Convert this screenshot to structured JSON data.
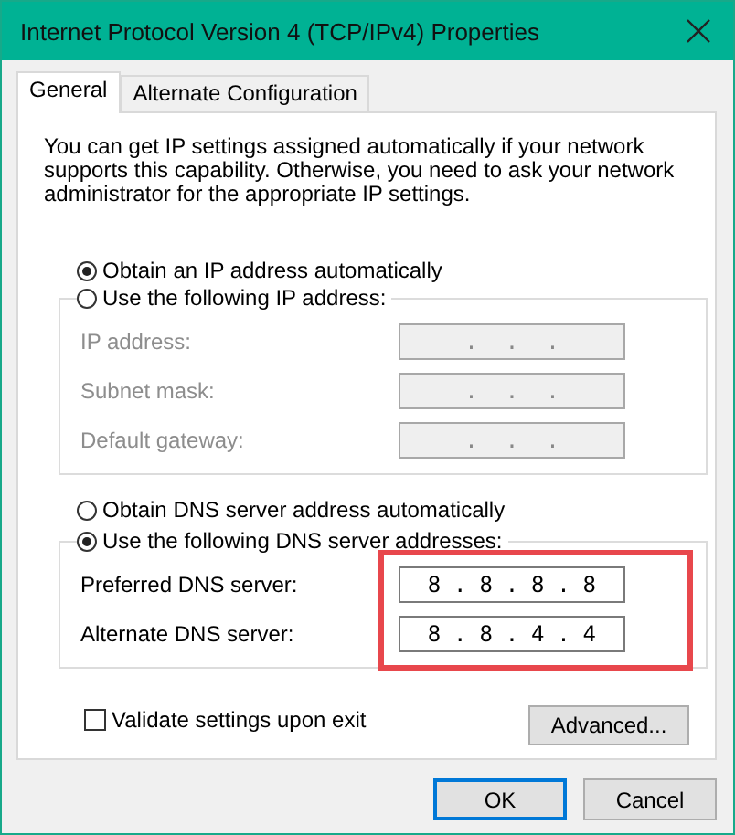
{
  "window": {
    "title": "Internet Protocol Version 4 (TCP/IPv4) Properties"
  },
  "tabs": [
    {
      "label": "General",
      "selected": true
    },
    {
      "label": "Alternate Configuration",
      "selected": false
    }
  ],
  "intro": "You can get IP settings assigned automatically if your network supports this capability. Otherwise, you need to ask your network administrator for the appropriate IP settings.",
  "ip_options": [
    {
      "label": "Obtain an IP address automatically",
      "selected": true
    },
    {
      "label": "Use the following IP address:",
      "selected": false
    }
  ],
  "ip_fields": [
    {
      "label": "IP address:",
      "disabled": true,
      "parts": [
        ".",
        ".",
        "."
      ]
    },
    {
      "label": "Subnet mask:",
      "disabled": true,
      "parts": [
        ".",
        ".",
        "."
      ]
    },
    {
      "label": "Default gateway:",
      "disabled": true,
      "parts": [
        ".",
        ".",
        "."
      ]
    }
  ],
  "dns_options": [
    {
      "label": "Obtain DNS server address automatically",
      "selected": false
    },
    {
      "label": "Use the following DNS server addresses:",
      "selected": true
    }
  ],
  "dns_fields": [
    {
      "label": "Preferred DNS server:",
      "disabled": false,
      "parts": [
        "8",
        ".",
        "8",
        ".",
        "8",
        ".",
        "8"
      ]
    },
    {
      "label": "Alternate DNS server:",
      "disabled": false,
      "parts": [
        "8",
        ".",
        "8",
        ".",
        "4",
        ".",
        "4"
      ]
    }
  ],
  "validate": {
    "label": "Validate settings upon exit",
    "checked": false
  },
  "advanced_button": "Advanced...",
  "buttons": [
    {
      "label": "OK",
      "default": true
    },
    {
      "label": "Cancel",
      "default": false
    }
  ]
}
